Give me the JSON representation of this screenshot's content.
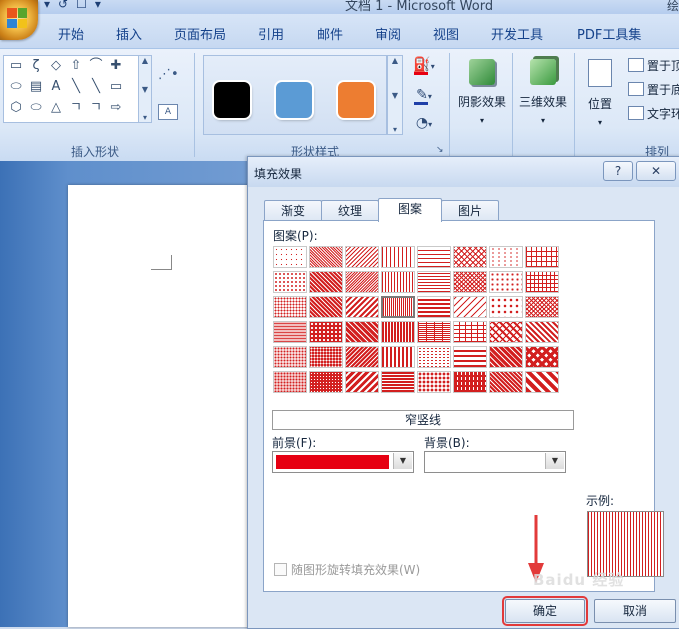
{
  "window": {
    "title": "文档 1 - Microsoft Word",
    "title_right_fragment": "绘"
  },
  "quick_access": [
    "▾",
    "↺",
    "☐",
    "▾"
  ],
  "ribbon_tabs": [
    "开始",
    "插入",
    "页面布局",
    "引用",
    "邮件",
    "审阅",
    "视图",
    "开发工具",
    "PDF工具集"
  ],
  "ribbon": {
    "insert_shapes_label": "插入形状",
    "shape_styles_label": "形状样式",
    "shadow_effects_label": "阴影效果",
    "threed_effects_label": "三维效果",
    "position_label": "位置",
    "arrange_label": "排列",
    "arrange_items": [
      "置于顶",
      "置于底",
      "文字环"
    ],
    "style_swatch_colors": [
      "#000000",
      "#5b9bd5",
      "#ed7d31"
    ],
    "shape_rows": [
      [
        "▭",
        "ζ",
        "◇",
        "⇧",
        "⌒",
        "✚"
      ],
      [
        "⬭",
        "▤",
        "A",
        "╲",
        "╲",
        "▭"
      ],
      [
        "⬡",
        "⬭",
        "△",
        "ㄱ",
        "ㄱ",
        "⇨"
      ]
    ]
  },
  "dialog": {
    "title": "填充效果",
    "help": "?",
    "close": "✕",
    "tabs": [
      "渐变",
      "纹理",
      "图案",
      "图片"
    ],
    "active_tab": "图案",
    "pattern_label": "图案(P):",
    "selected_pattern_name": "窄竖线",
    "foreground_label": "前景(F):",
    "background_label": "背景(B):",
    "foreground_color": "#e60012",
    "background_color": "#ffffff",
    "sample_label": "示例:",
    "rotate_checkbox_label": "随图形旋转填充效果(W)",
    "rotate_checked": false,
    "ok_label": "确定",
    "cancel_label": "取消",
    "pattern_color": "#d21f1f"
  },
  "watermark": "Baidu 经验"
}
